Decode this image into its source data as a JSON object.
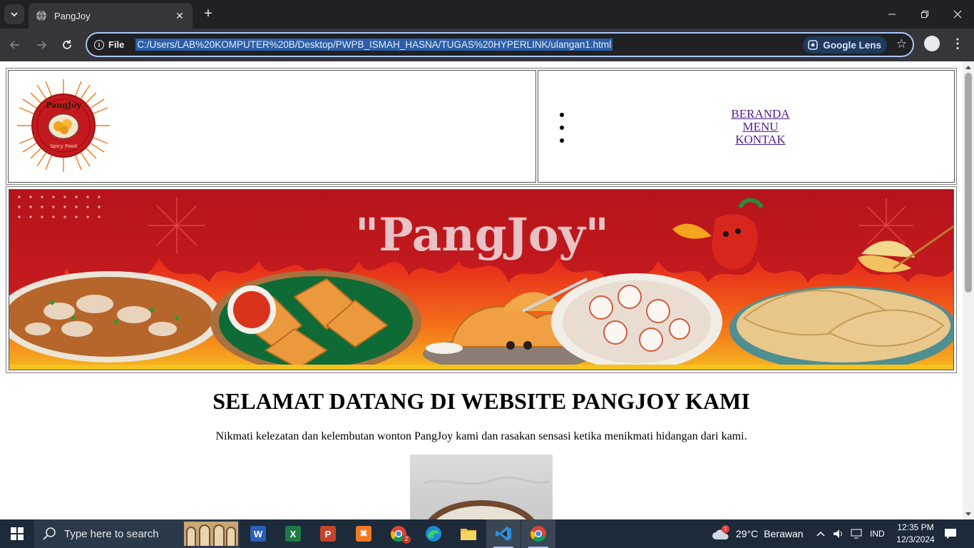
{
  "browser": {
    "tab_title": "PangJoy",
    "site_info_label": "File",
    "url": "C:/Users/LAB%20KOMPUTER%20B/Desktop/PWPB_ISMAH_HASNA/TUGAS%20HYPERLINK/ulangan1.html",
    "lens_label": "Google Lens"
  },
  "page": {
    "logo_top_text": "PangJoy",
    "logo_bottom_text": "Spicy Food",
    "nav": [
      "BERANDA",
      "MENU",
      "KONTAK"
    ],
    "banner_title": "\"PangJoy\"",
    "heading": "SELAMAT DATANG DI WEBSITE PANGJOY KAMI",
    "tagline": "Nikmati kelezatan dan kelembutan wonton PangJoy kami dan rasakan sensasi ketika menikmati hidangan dari kami."
  },
  "taskbar": {
    "search_placeholder": "Type here to search",
    "chrome_badge": "2",
    "weather_badge": "1",
    "temperature": "29°C",
    "weather": "Berawan",
    "language": "IND",
    "time": "12:35 PM",
    "date": "12/3/2024"
  },
  "colors": {
    "banner_red": "#c0161c",
    "flame_orange": "#f46a10",
    "link": "#551a8b",
    "taskbar": "#1c2a3a",
    "chrome_dark": "#202124"
  }
}
